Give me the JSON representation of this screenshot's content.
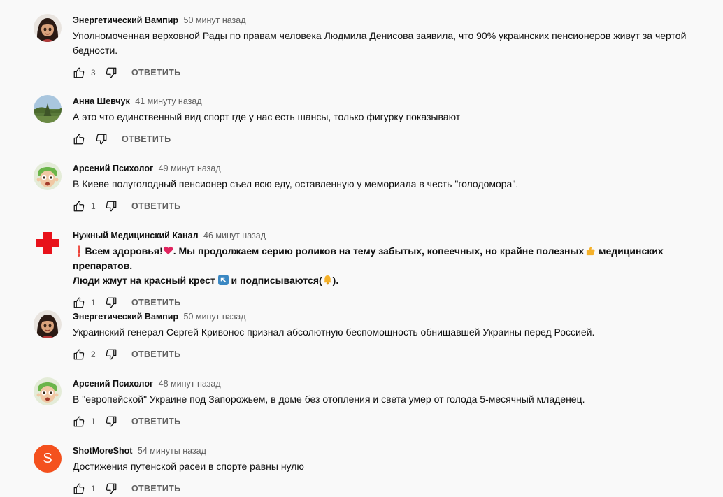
{
  "reply_label": "ОТВЕТИТЬ",
  "comments": [
    {
      "author": "Энергетический Вампир",
      "time": "50 минут назад",
      "text": "Уполномоченная верховной Рады по правам человека Людмила Денисова заявила, что 90% украинских пенсионеров живут за чертой бедности.",
      "likes": "3",
      "avatar": "cartoon-girl-avatar"
    },
    {
      "author": "Анна Шевчук",
      "time": "41 минуту назад",
      "text": "А это что единственный вид спорт где у нас есть шансы, только фигурку показывают",
      "likes": "",
      "avatar": "landscape-avatar"
    },
    {
      "author": "Арсений Психолог",
      "time": "49 минут назад",
      "text": "В Киеве полуголодный пенсионер съел всю еду, оставленную у мемориала в честь \"голодомора\".",
      "likes": "1",
      "avatar": "cartoon-boy-avatar"
    },
    {
      "author": "Нужный Медицинский Канал",
      "time": "46 минут назад",
      "text_parts": {
        "p1": "Всем здоровья!",
        "p2": ". Мы продолжаем серию роликов на тему забытых, копеечных, но крайне полезных",
        "p3": " медицинских препаратов.",
        "p4": "Люди жмут на красный крест ",
        "p5": " и подписываются(",
        "p6": ")."
      },
      "likes": "1",
      "avatar": "red-cross-avatar"
    },
    {
      "author": "Энергетический Вампир",
      "time": "50 минут назад",
      "text": "Украинский генерал Сергей Кривонос признал абсолютную беспомощность обнищавшей Украины перед Россией.",
      "likes": "2",
      "avatar": "cartoon-girl-avatar"
    },
    {
      "author": "Арсений Психолог",
      "time": "48 минут назад",
      "text": "В \"европейской\" Украине под Запорожьем, в доме без отопления и света умер от голода 5-месячный младенец.",
      "likes": "1",
      "avatar": "cartoon-boy-avatar"
    },
    {
      "author": "ShotMoreShot",
      "time": "54 минуты назад",
      "text": "Достижения путенской расеи в спорте равны нулю",
      "likes": "1",
      "avatar_letter": "S",
      "avatar_color": "#f4511e"
    }
  ]
}
